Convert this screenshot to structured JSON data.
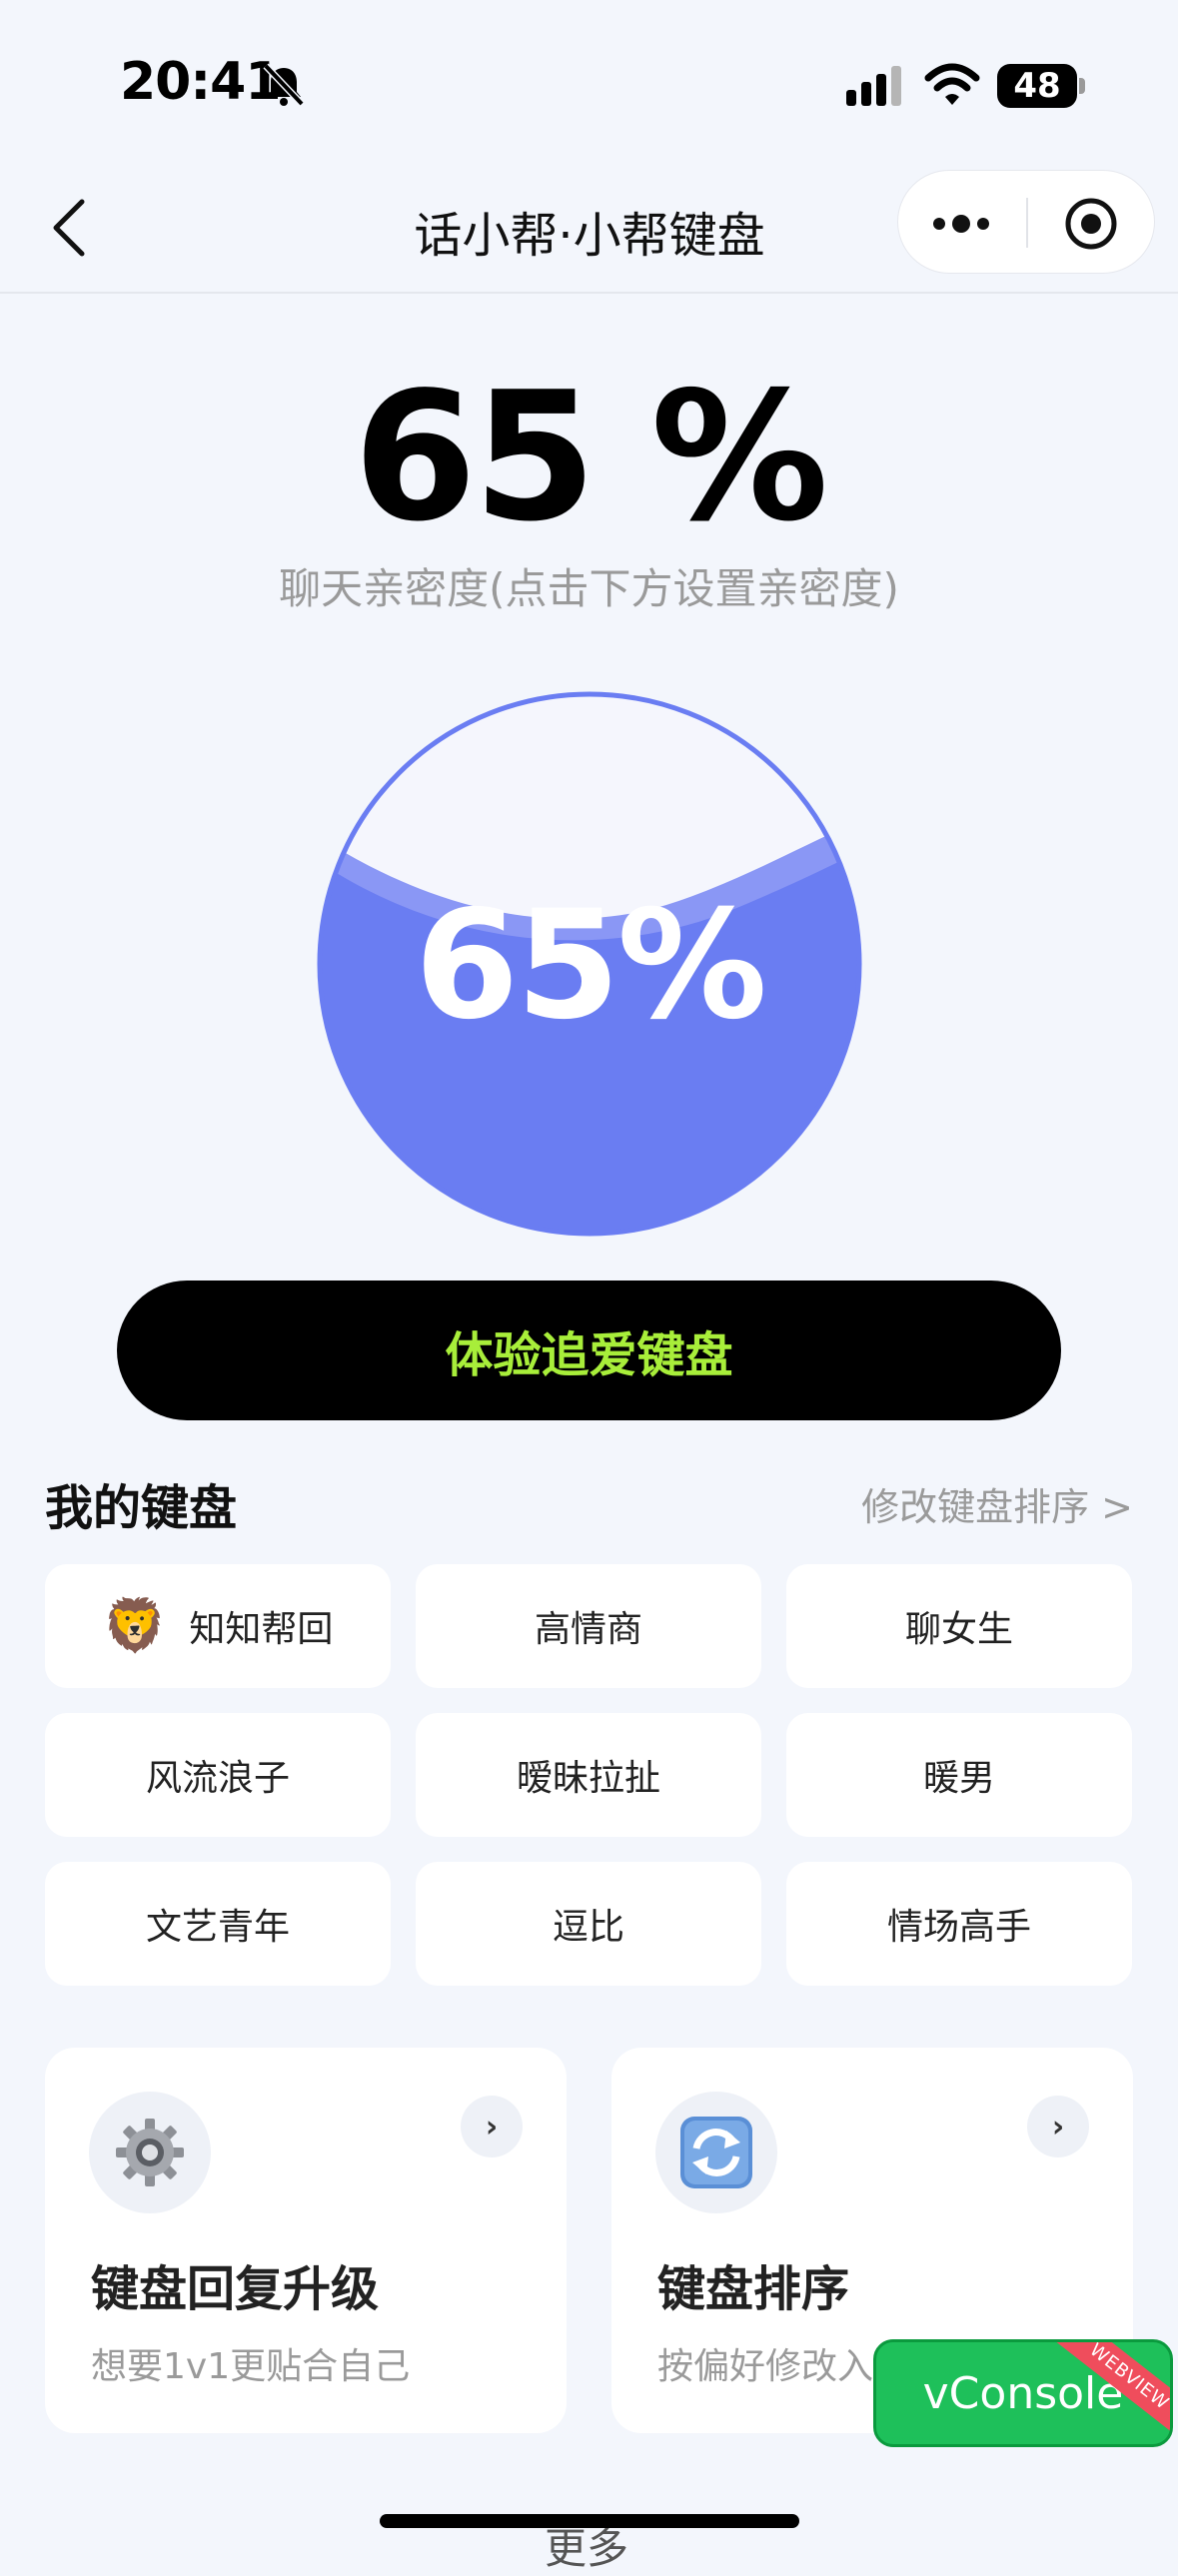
{
  "status_bar": {
    "time": "20:41",
    "battery": "48"
  },
  "nav": {
    "title": "话小帮·小帮键盘"
  },
  "intimacy": {
    "percent_text": "65 %",
    "subtitle": "聊天亲密度(点击下方设置亲密度)",
    "gauge_text": "65%",
    "level": 0.65
  },
  "cta": {
    "label": "体验追爱键盘"
  },
  "my_keyboards": {
    "title": "我的键盘",
    "reorder_link": "修改键盘排序 >",
    "items": [
      "知知帮回",
      "高情商",
      "聊女生",
      "风流浪子",
      "暧昧拉扯",
      "暖男",
      "文艺青年",
      "逗比",
      "情场高手"
    ]
  },
  "cards": [
    {
      "title": "键盘回复升级",
      "subtitle": "想要1v1更贴合自己",
      "arrow": "›"
    },
    {
      "title": "键盘排序",
      "subtitle": "按偏好修改入",
      "arrow": "›"
    }
  ],
  "vconsole": {
    "label": "vConsole",
    "ribbon": "WEBVIEW"
  },
  "footer": {
    "more": "更多"
  },
  "colors": {
    "accent": "#6a7df2",
    "cta_text": "#a8ee3a",
    "background": "#f3f6fc"
  }
}
